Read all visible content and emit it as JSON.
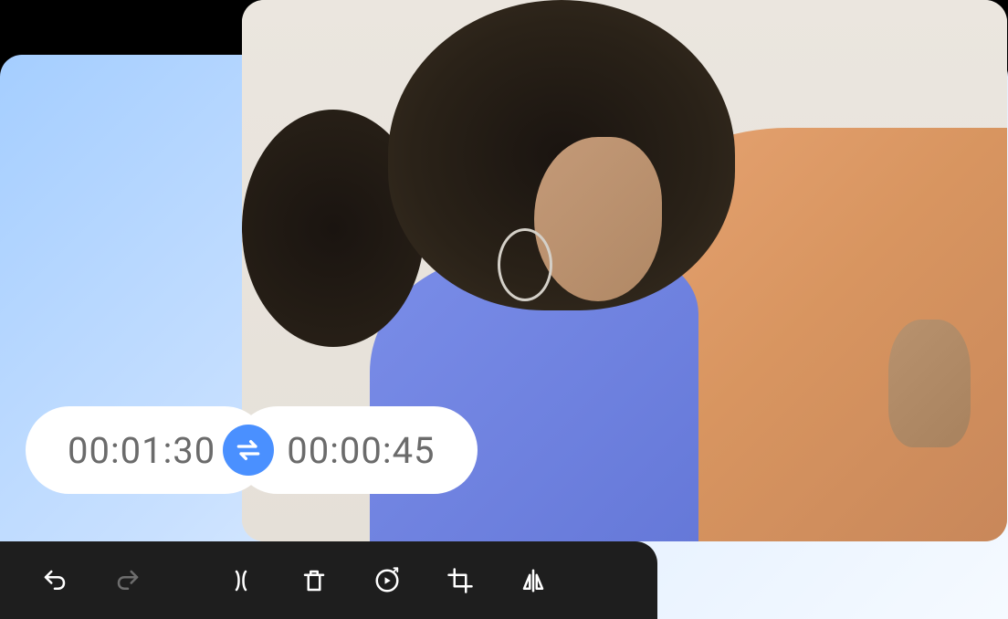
{
  "timeline": {
    "time_left": "00:01:30",
    "time_right": "00:00:45"
  },
  "toolbar": {
    "undo": "undo",
    "redo": "redo",
    "split": "split",
    "delete": "delete",
    "speed": "speed",
    "crop": "crop",
    "mirror": "mirror"
  },
  "colors": {
    "accent": "#4a90ff",
    "toolbar_bg": "#1e1e1e",
    "pill_bg": "#ffffff",
    "time_text": "#6b6b6b"
  }
}
